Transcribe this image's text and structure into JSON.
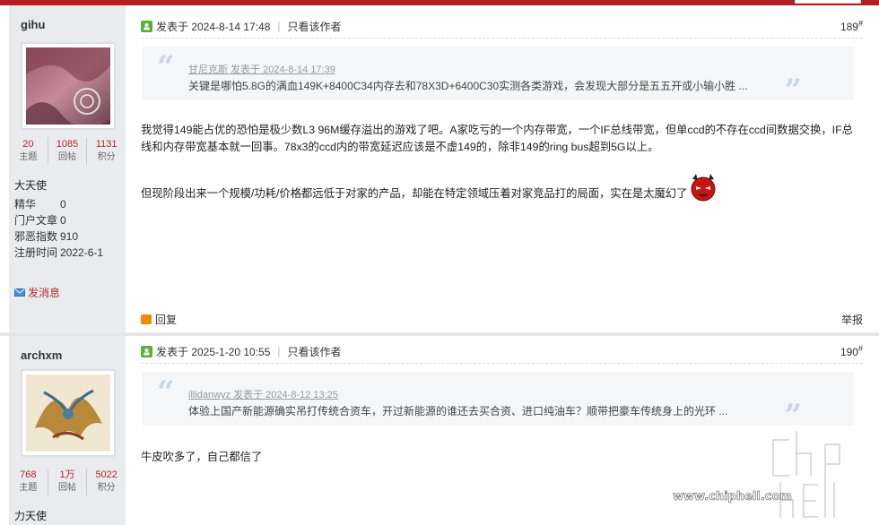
{
  "posts": [
    {
      "user": {
        "name": "gihu",
        "stats": [
          {
            "value": "20",
            "label": "主题"
          },
          {
            "value": "1085",
            "label": "回帖"
          },
          {
            "value": "1131",
            "label": "积分"
          }
        ],
        "group": "大天使",
        "info": [
          {
            "key": "精华",
            "value": "0"
          },
          {
            "key": "门户文章",
            "value": "0"
          },
          {
            "key": "邪恶指数",
            "value": "910"
          },
          {
            "key": "注册时间",
            "value": "2022-6-1"
          }
        ],
        "message_label": "发消息"
      },
      "posted_at": "发表于 2024-8-14 17:48",
      "only_author": "只看该作者",
      "floor": "189",
      "floor_sup": "#",
      "quote": {
        "who": "甘尼克斯 发表于 2024-8-14 17:39",
        "text": "关键是哪怕5.8G的满血149K+8400C34内存去和78X3D+6400C30实测各类游戏，会发现大部分是五五开或小输小胜 ..."
      },
      "paragraphs": [
        "我觉得149能占优的恐怕是极少数L3 96M缓存溢出的游戏了吧。A家吃亏的一个内存带宽，一个IF总线带宽，但单ccd的不存在ccd间数据交换，IF总线和内存带宽基本就一回事。78x3的ccd内的带宽延迟应该是不虚149的，除非149的ring bus超到5G以上。",
        "但现阶段出来一个规模/功耗/价格都远低于对家的产品，却能在特定领域压着对家竞品打的局面，实在是太魔幻了"
      ],
      "reply_label": "回复",
      "report_label": "举报"
    },
    {
      "user": {
        "name": "archxm",
        "stats": [
          {
            "value": "768",
            "label": "主题"
          },
          {
            "value": "1万",
            "label": "回帖"
          },
          {
            "value": "5022",
            "label": "积分"
          }
        ],
        "group": "力天使"
      },
      "posted_at": "发表于 2025-1-20 10:55",
      "only_author": "只看该作者",
      "floor": "190",
      "floor_sup": "#",
      "quote": {
        "who": "illidanwyz 发表于 2024-8-12 13:25",
        "text": "体验上国产新能源确实吊打传统合资车，开过新能源的谁还去买合资、进口纯油车？顺带把豪车传统身上的光环 ..."
      },
      "paragraphs": [
        "牛皮吹多了，自己都信了"
      ]
    }
  ],
  "watermark": {
    "brand": "chip hell",
    "url": "www.chiphell.com"
  },
  "colors": {
    "accent": "#b21e21",
    "stat_number": "#b0282c",
    "sidebar_bg": "#e9ebee",
    "quote_bg": "#f5f6f7"
  }
}
